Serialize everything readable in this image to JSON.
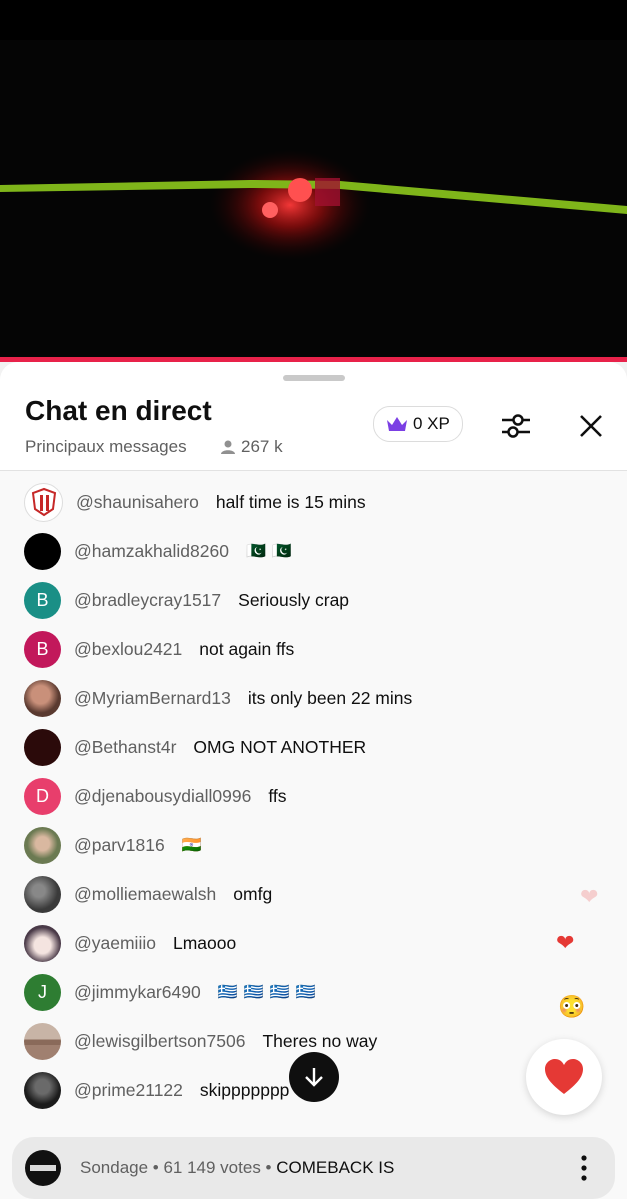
{
  "video": {
    "description_icon": "stadium-concert-scene"
  },
  "header": {
    "title": "Chat en direct",
    "subtitle": "Principaux messages",
    "viewers": "267 k",
    "xp": "0 XP"
  },
  "messages": [
    {
      "author": "@shaunisahero",
      "text": "half time is 15 mins",
      "avatar_color": "#ffffff",
      "avatar_letter": ""
    },
    {
      "author": "@hamzakhalid8260",
      "text": "",
      "avatar_color": "#000000",
      "avatar_letter": ""
    },
    {
      "author": "@bradleycray1517",
      "text": "Seriously crap",
      "avatar_color": "#1a8f86",
      "avatar_letter": "B"
    },
    {
      "author": "@bexlou2421",
      "text": "not again ffs",
      "avatar_color": "#c2185b",
      "avatar_letter": "B"
    },
    {
      "author": "@MyriamBernard13",
      "text": "its only been 22 mins",
      "avatar_color": "#5a3a30",
      "avatar_letter": ""
    },
    {
      "author": "@Bethanst4r",
      "text": "OMG NOT ANOTHER",
      "avatar_color": "#2b0a0a",
      "avatar_letter": ""
    },
    {
      "author": "@djenabousydiall0996",
      "text": "ffs",
      "avatar_color": "#e83e6c",
      "avatar_letter": "D"
    },
    {
      "author": "@parv1816",
      "text": "",
      "avatar_color": "#6b7a52",
      "avatar_letter": ""
    },
    {
      "author": "@molliemaewalsh",
      "text": "omfg",
      "avatar_color": "#3a3a3a",
      "avatar_letter": ""
    },
    {
      "author": "@yaemiiio",
      "text": "Lmaooo",
      "avatar_color": "#d8d0d0",
      "avatar_letter": ""
    },
    {
      "author": "@jimmykar6490",
      "text": "",
      "avatar_color": "#2e7d32",
      "avatar_letter": "J"
    },
    {
      "author": "@lewisgilbertson7506",
      "text": "Theres no way",
      "avatar_color": "#8a6a5a",
      "avatar_letter": ""
    },
    {
      "author": "@prime21122",
      "text": "skippppppp",
      "avatar_color": "#1c1c1c",
      "avatar_letter": ""
    }
  ],
  "flags": {
    "pakistan": "🇵🇰",
    "india": "🇮🇳",
    "greece": "🇬🇷"
  },
  "poll": {
    "meta": "Sondage • 61 149 votes •",
    "question": "COMEBACK IS"
  },
  "colors": {
    "accent": "#e8224a",
    "xp_crown": "#7b3fe4"
  }
}
